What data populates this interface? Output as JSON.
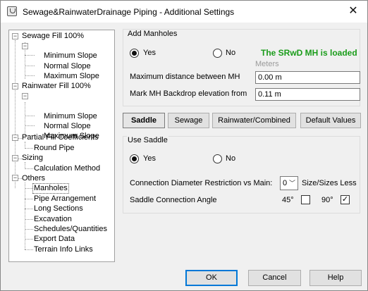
{
  "window": {
    "title": "Sewage&RainwaterDrainage Piping  - Additional Settings",
    "close_glyph": "✕"
  },
  "tree": {
    "nodes": [
      {
        "label": "Sewage Fill 100%",
        "expanded": true
      },
      {
        "label": "Minimum Slope"
      },
      {
        "label": "Normal Slope"
      },
      {
        "label": "Maximum Slope"
      },
      {
        "label": "Rainwater Fill 100%",
        "expanded": true
      },
      {
        "label": "Minimum Slope"
      },
      {
        "label": "Normal Slope"
      },
      {
        "label": "Maximum Slope"
      },
      {
        "label": "Partial Fill Coefficients",
        "expanded": true
      },
      {
        "label": "Round Pipe"
      },
      {
        "label": "Sizing",
        "expanded": true
      },
      {
        "label": "Calculation Method"
      },
      {
        "label": "Others",
        "expanded": true
      },
      {
        "label": "Manholes",
        "selected": true
      },
      {
        "label": "Pipe Arrangement"
      },
      {
        "label": "Long Sections"
      },
      {
        "label": "Excavation"
      },
      {
        "label": "Schedules/Quantities"
      },
      {
        "label": "Export Data"
      },
      {
        "label": "Terrain Info Links"
      }
    ],
    "expander_glyph": "−"
  },
  "add_manholes": {
    "title": "Add Manholes",
    "yes_label": "Yes",
    "no_label": "No",
    "selected": "Yes",
    "status": "The SRwD MH is loaded",
    "units_hint": "Meters",
    "max_distance_label": "Maximum distance between MH",
    "max_distance_value": "0.00 m",
    "backdrop_label": "Mark MH Backdrop elevation from",
    "backdrop_value": "0.11 m"
  },
  "tabs": [
    {
      "label": "Saddle",
      "active": true
    },
    {
      "label": "Sewage"
    },
    {
      "label": "Rainwater/Combined"
    },
    {
      "label": "Default Values"
    }
  ],
  "use_saddle": {
    "title": "Use Saddle",
    "yes_label": "Yes",
    "no_label": "No",
    "selected": "Yes",
    "diameter_label": "Connection Diameter Restriction vs Main:",
    "diameter_value": "0",
    "diameter_suffix": "Size/Sizes Less",
    "angle_label": "Saddle Connection Angle",
    "angle_45_label": "45°",
    "angle_45_checked": false,
    "angle_90_label": "90°",
    "angle_90_checked": true,
    "check_glyph": "✓",
    "chevron_glyph": "﹀"
  },
  "buttons": {
    "ok": "OK",
    "cancel": "Cancel",
    "help": "Help"
  }
}
